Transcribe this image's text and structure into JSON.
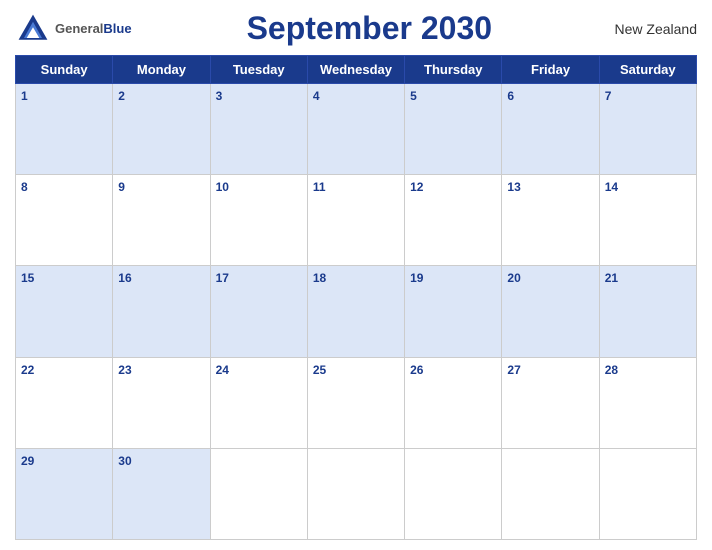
{
  "header": {
    "logo_general": "General",
    "logo_blue": "Blue",
    "title": "September 2030",
    "country": "New Zealand"
  },
  "days_of_week": [
    "Sunday",
    "Monday",
    "Tuesday",
    "Wednesday",
    "Thursday",
    "Friday",
    "Saturday"
  ],
  "weeks": [
    [
      1,
      2,
      3,
      4,
      5,
      6,
      7
    ],
    [
      8,
      9,
      10,
      11,
      12,
      13,
      14
    ],
    [
      15,
      16,
      17,
      18,
      19,
      20,
      21
    ],
    [
      22,
      23,
      24,
      25,
      26,
      27,
      28
    ],
    [
      29,
      30,
      null,
      null,
      null,
      null,
      null
    ]
  ]
}
